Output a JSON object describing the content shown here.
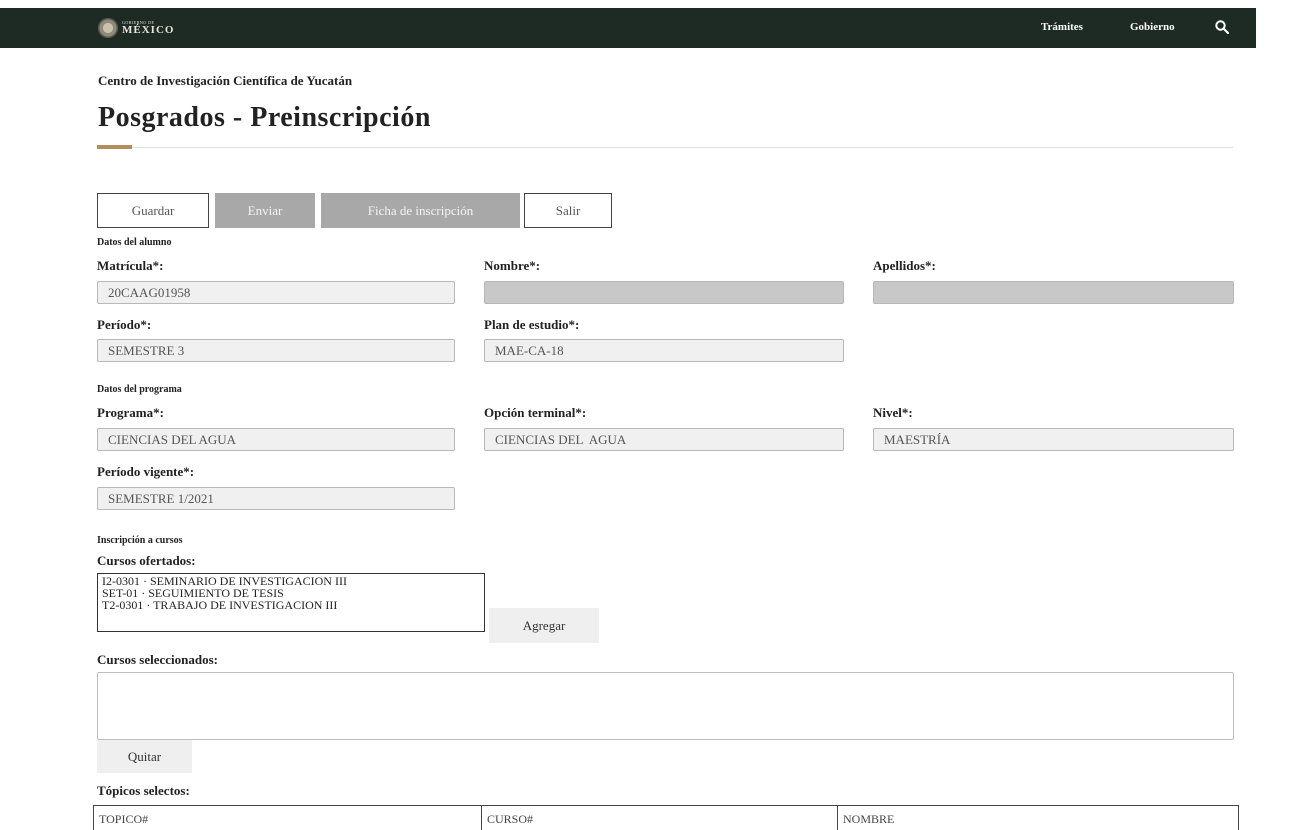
{
  "navbar": {
    "logo_small": "GOBIERNO DE",
    "logo_big": "MÉXICO",
    "links": [
      "Trámites",
      "Gobierno"
    ],
    "search_icon": "search-icon"
  },
  "header": {
    "institution": "Centro de Investigación Científica de Yucatán",
    "title": "Posgrados - Preinscripción"
  },
  "toolbar": {
    "guardar": "Guardar",
    "enviar": "Enviar",
    "ficha": "Ficha de inscripción",
    "salir": "Salir"
  },
  "alumno": {
    "section": "Datos del alumno",
    "matricula_label": "Matrícula*:",
    "matricula_value": "20CAAG01958",
    "nombre_label": "Nombre*:",
    "nombre_value": "",
    "apellidos_label": "Apellidos*:",
    "apellidos_value": "",
    "periodo_label": "Período*:",
    "periodo_value": "SEMESTRE 3",
    "plan_label": "Plan de estudio*:",
    "plan_value": "MAE-CA-18"
  },
  "programa": {
    "section": "Datos del programa",
    "programa_label": "Programa*:",
    "programa_value": "CIENCIAS DEL AGUA",
    "opcion_label": "Opción terminal*:",
    "opcion_value": "CIENCIAS DEL  AGUA",
    "nivel_label": "Nivel*:",
    "nivel_value": "MAESTRÍA",
    "vigente_label": "Período vigente*:",
    "vigente_value": "SEMESTRE 1/2021"
  },
  "cursos": {
    "section": "Inscripción a cursos",
    "ofertados_label": "Cursos ofertados:",
    "ofertados": [
      "I2-0301 · SEMINARIO DE INVESTIGACION III",
      "SET-01 · SEGUIMIENTO DE TESIS",
      "T2-0301 · TRABAJO DE INVESTIGACION III"
    ],
    "agregar": "Agregar",
    "seleccionados_label": "Cursos seleccionados:",
    "quitar": "Quitar",
    "topicos_label": "Tópicos selectos:",
    "topicos_headers": [
      "TOPICO#",
      "CURSO#",
      "NOMBRE"
    ]
  }
}
